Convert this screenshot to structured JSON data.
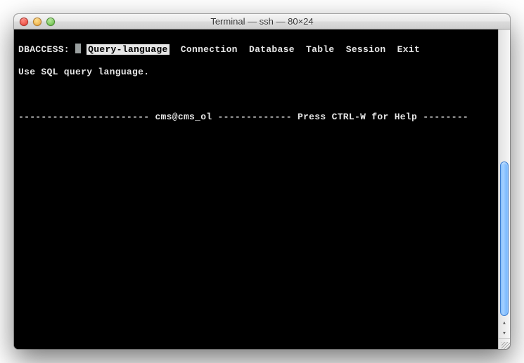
{
  "window": {
    "title": "Terminal — ssh — 80×24"
  },
  "menu": {
    "prompt": "DBACCESS:",
    "items": [
      {
        "label": "Query-language",
        "selected": true
      },
      {
        "label": "Connection",
        "selected": false
      },
      {
        "label": "Database",
        "selected": false
      },
      {
        "label": "Table",
        "selected": false
      },
      {
        "label": "Session",
        "selected": false
      },
      {
        "label": "Exit",
        "selected": false
      }
    ]
  },
  "hint": "Use SQL query language.",
  "status": {
    "left": "----------------------- ",
    "db": "cms@cms_ol",
    "mid": " ------------- ",
    "help": "Press CTRL-W for Help",
    "right": " --------"
  }
}
